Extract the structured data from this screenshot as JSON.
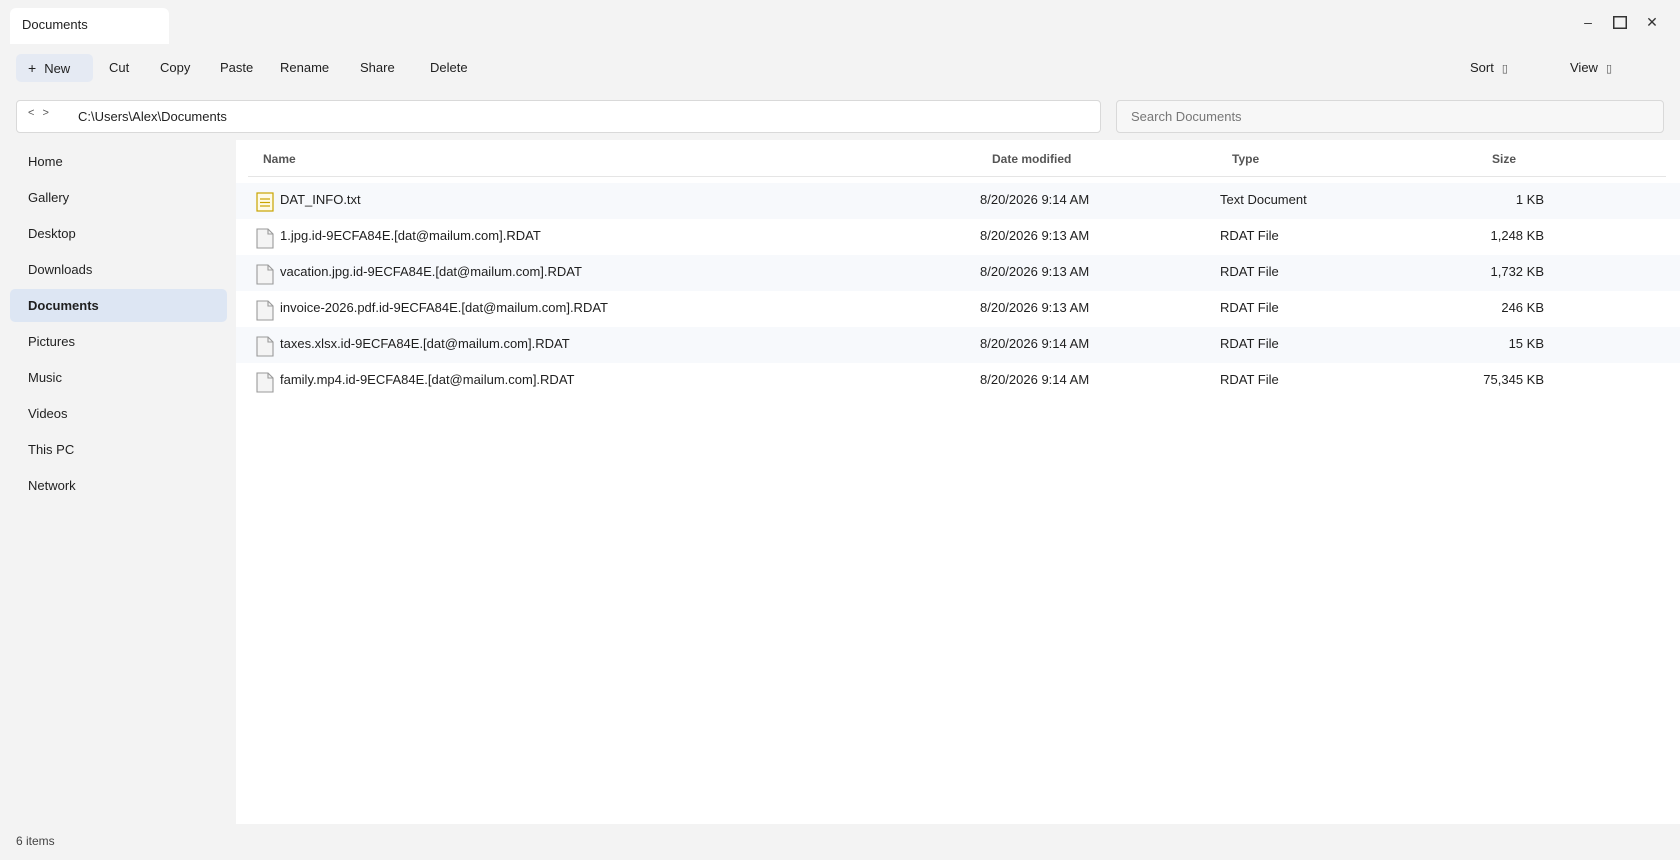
{
  "window": {
    "tab_title": "Documents",
    "controls": {
      "minimize": "–",
      "close": "✕"
    }
  },
  "toolbar": {
    "new_label": "New",
    "new_plus": "+",
    "cut": "Cut",
    "copy": "Copy",
    "paste": "Paste",
    "rename": "Rename",
    "share": "Share",
    "delete": "Delete",
    "sort": "Sort",
    "view": "View"
  },
  "address": {
    "back": "<",
    "forward": ">",
    "path": "C:\\Users\\Alex\\Documents"
  },
  "search": {
    "placeholder": "Search Documents"
  },
  "sidebar": {
    "items": [
      {
        "label": "Home"
      },
      {
        "label": "Gallery"
      },
      {
        "label": "Desktop"
      },
      {
        "label": "Downloads"
      },
      {
        "label": "Documents",
        "active": true
      },
      {
        "label": "Pictures"
      },
      {
        "label": "Music"
      },
      {
        "label": "Videos"
      },
      {
        "label": "This PC"
      },
      {
        "label": "Network"
      }
    ]
  },
  "columns": {
    "name": "Name",
    "date": "Date modified",
    "type": "Type",
    "size": "Size"
  },
  "files": [
    {
      "name": "DAT_INFO.txt",
      "date": "8/20/2026 9:14 AM",
      "type": "Text Document",
      "size": "1 KB",
      "icon": "text-file-icon"
    },
    {
      "name": "1.jpg.id-9ECFA84E.[dat@mailum.com].RDAT",
      "date": "8/20/2026 9:13 AM",
      "type": "RDAT File",
      "size": "1,248 KB",
      "icon": "file-icon"
    },
    {
      "name": "vacation.jpg.id-9ECFA84E.[dat@mailum.com].RDAT",
      "date": "8/20/2026 9:13 AM",
      "type": "RDAT File",
      "size": "1,732 KB",
      "icon": "file-icon"
    },
    {
      "name": "invoice-2026.pdf.id-9ECFA84E.[dat@mailum.com].RDAT",
      "date": "8/20/2026 9:13 AM",
      "type": "RDAT File",
      "size": "246 KB",
      "icon": "file-icon"
    },
    {
      "name": "taxes.xlsx.id-9ECFA84E.[dat@mailum.com].RDAT",
      "date": "8/20/2026 9:14 AM",
      "type": "RDAT File",
      "size": "15 KB",
      "icon": "file-icon"
    },
    {
      "name": "family.mp4.id-9ECFA84E.[dat@mailum.com].RDAT",
      "date": "8/20/2026 9:14 AM",
      "type": "RDAT File",
      "size": "75,345 KB",
      "icon": "file-icon"
    }
  ],
  "status": {
    "item_count": "6 items"
  },
  "colors": {
    "accent_selected": "#dde6f3",
    "new_button_bg": "#e5eaf3",
    "text_icon": "#c9a400",
    "row_alt": "#f7f9fc"
  }
}
